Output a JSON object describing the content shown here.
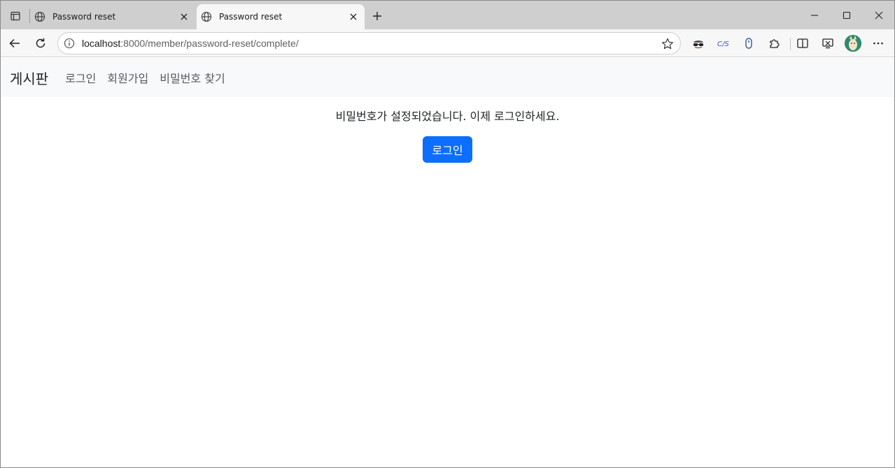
{
  "browser": {
    "tabs": [
      {
        "title": "Password reset",
        "active": false
      },
      {
        "title": "Password reset",
        "active": true
      }
    ],
    "url_host": "localhost",
    "url_path": ":8000/member/password-reset/complete/",
    "extensions": [
      "incognito-mask-icon",
      "cjs-extension-icon",
      "mouse-extension-icon"
    ],
    "accent": "#0d6efd"
  },
  "navbar": {
    "brand": "게시판",
    "links": [
      "로그인",
      "회원가입",
      "비밀번호 찾기"
    ]
  },
  "main": {
    "message": "비밀번호가 설정되었습니다. 이제 로그인하세요.",
    "login_button": "로그인"
  }
}
